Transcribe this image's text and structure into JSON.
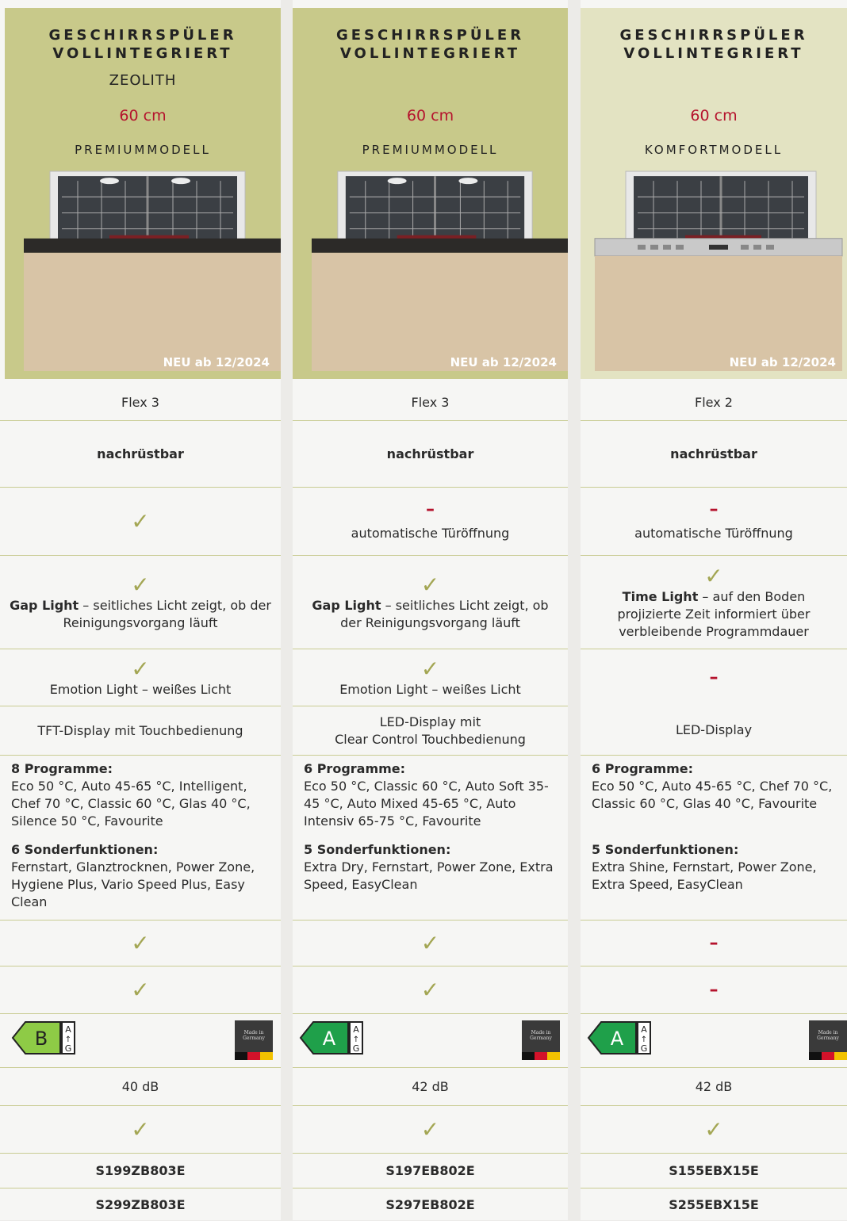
{
  "colors": {
    "accent_green": "#c8c98a",
    "pale_green": "#e3e3c2",
    "red": "#b5132d",
    "check": "#a3a653",
    "energy_green": "#1fa04a",
    "energy_lightgreen": "#8ecb46"
  },
  "columns": [
    {
      "category": "GESCHIRRSPÜLER VOLLINTEGRIERT",
      "subtitle": "ZEOLITH",
      "size": "60 cm",
      "model_type": "PREMIUMMODELL",
      "badge": "NEU ab 12/2024",
      "flex": "Flex 3",
      "retrofit": "nachrüstbar",
      "door_open_text": "",
      "light_title": "Gap Light",
      "light_desc": " – seitliches Licht zeigt, ob der Reinigungsvorgang läuft",
      "emotion_light": "Emotion Light – weißes Licht",
      "display_line1": "TFT-Display mit Touchbedienung",
      "display_line2": "",
      "programs_title": "8 Programme:",
      "programs": "Eco 50 °C, Auto 45-65 °C, Intelligent, Chef 70 °C, Classic 60 °C, Glas 40 °C, Silence 50 °C, Favourite",
      "special_title": "6 Sonderfunktionen:",
      "special": "Fernstart, Glanztrocknen, Power Zone, Hygiene Plus, Vario Speed Plus, Easy Clean",
      "energy_class": "B",
      "energy_scale_top": "A",
      "energy_scale_bottom": "G",
      "made_in": "Made in Germany",
      "noise": "40 dB",
      "model_code_1": "S199ZB803E",
      "model_code_2": "S299ZB803E"
    },
    {
      "category": "GESCHIRRSPÜLER VOLLINTEGRIERT",
      "subtitle": "",
      "size": "60 cm",
      "model_type": "PREMIUMMODELL",
      "badge": "NEU ab 12/2024",
      "flex": "Flex 3",
      "retrofit": "nachrüstbar",
      "door_open_text": "automatische Türöffnung",
      "light_title": "Gap Light",
      "light_desc": " – seitliches Licht zeigt, ob der Reinigungsvorgang läuft",
      "emotion_light": "Emotion Light – weißes Licht",
      "display_line1": "LED-Display mit",
      "display_line2": "Clear Control Touchbedienung",
      "programs_title": "6 Programme:",
      "programs": "Eco 50 °C, Classic 60 °C, Auto Soft 35-45 °C, Auto Mixed 45-65 °C, Auto Intensiv 65-75 °C, Favourite",
      "special_title": "5 Sonderfunktionen:",
      "special": "Extra Dry, Fernstart, Power Zone, Extra Speed, EasyClean",
      "energy_class": "A",
      "energy_scale_top": "A",
      "energy_scale_bottom": "G",
      "made_in": "Made in Germany",
      "noise": "42 dB",
      "model_code_1": "S197EB802E",
      "model_code_2": "S297EB802E"
    },
    {
      "category": "GESCHIRRSPÜLER VOLLINTEGRIERT",
      "subtitle": "",
      "size": "60 cm",
      "model_type": "KOMFORTMODELL",
      "badge": "NEU ab 12/2024",
      "flex": "Flex 2",
      "retrofit": "nachrüstbar",
      "door_open_text": "automatische Türöffnung",
      "light_title": "Time Light",
      "light_desc": " – auf den Boden projizierte Zeit informiert über verbleibende Programmdauer",
      "emotion_light": "",
      "display_line1": "LED-Display",
      "display_line2": "",
      "programs_title": "6 Programme:",
      "programs": "Eco 50 °C, Auto 45-65 °C, Chef 70 °C, Classic 60 °C, Glas 40 °C, Favourite",
      "special_title": "5 Sonderfunktionen:",
      "special": "Extra Shine, Fernstart, Power Zone, Extra Speed, EasyClean",
      "energy_class": "A",
      "energy_scale_top": "A",
      "energy_scale_bottom": "G",
      "made_in": "Made in Germany",
      "noise": "42 dB",
      "model_code_1": "S155EBX15E",
      "model_code_2": "S255EBX15E"
    }
  ],
  "marks": {
    "check": "✓",
    "dash": "–"
  }
}
